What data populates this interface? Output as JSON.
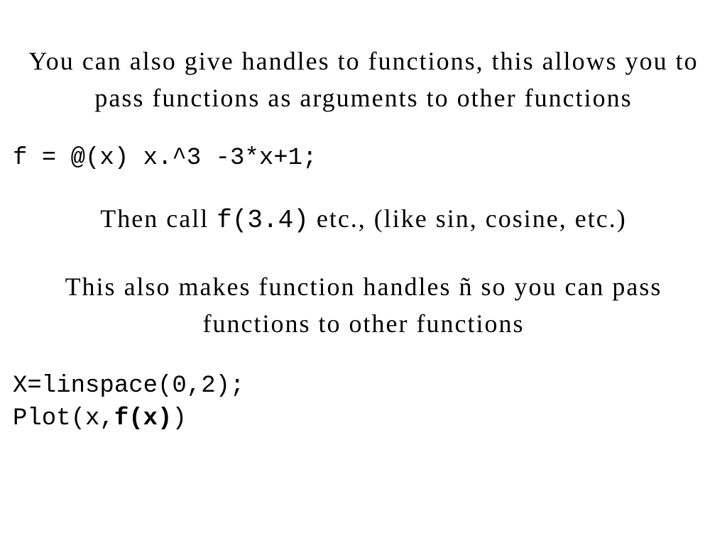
{
  "para1": "You can also give handles to functions, this allows you to pass functions as arguments to other functions",
  "code1": "f = @(x) x.^3 -3*x+1;",
  "para2_pre": "Then call ",
  "para2_code": "f(3.4)",
  "para2_post": " etc., (like sin, cosine, etc.)",
  "para3": "This also makes function handles ñ so you can pass functions to other functions",
  "code2_line1": "X=linspace(0,2);",
  "code2_line2_pre": "Plot(x,",
  "code2_line2_bold": "f(x)",
  "code2_line2_post": ")"
}
